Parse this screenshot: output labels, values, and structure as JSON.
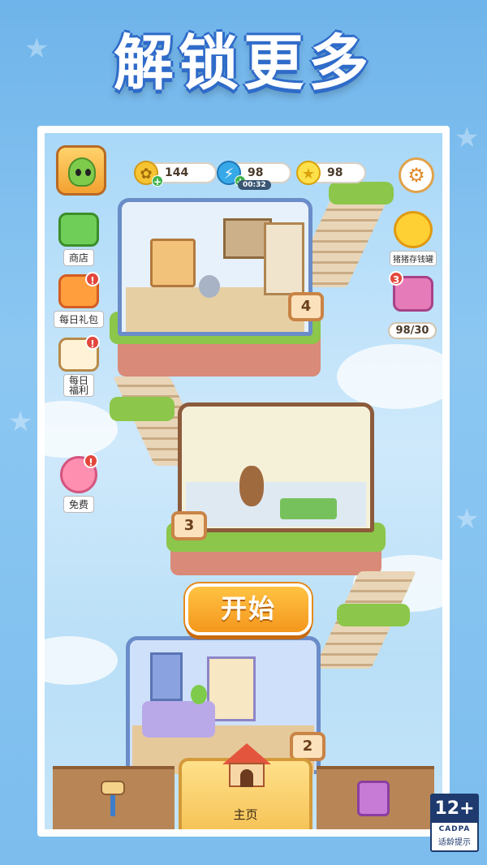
{
  "headline": "解锁更多",
  "resources": {
    "coins": "144",
    "energy": "98",
    "energy_timer": "00:32",
    "stars": "98"
  },
  "side_left": {
    "shop": "商店",
    "daily_gift": "每日礼包",
    "daily_welfare": "每日\n福利",
    "free": "免费"
  },
  "side_right": {
    "piggy_bank": "猪猪存钱罐",
    "chest_badge": "3",
    "chest_progress": "98/30"
  },
  "alert_mark": "!",
  "floors": {
    "f4": "4",
    "f3": "3",
    "f2": "2"
  },
  "start_button": "开始",
  "bottom_nav": {
    "home": "主页"
  },
  "age_rating": {
    "rating": "12+",
    "org": "CADPA",
    "note": "适龄提示"
  },
  "colors": {
    "start_button": "#f4971d",
    "headline_outline": "#2f6bc9",
    "grass": "#8cc64a"
  }
}
